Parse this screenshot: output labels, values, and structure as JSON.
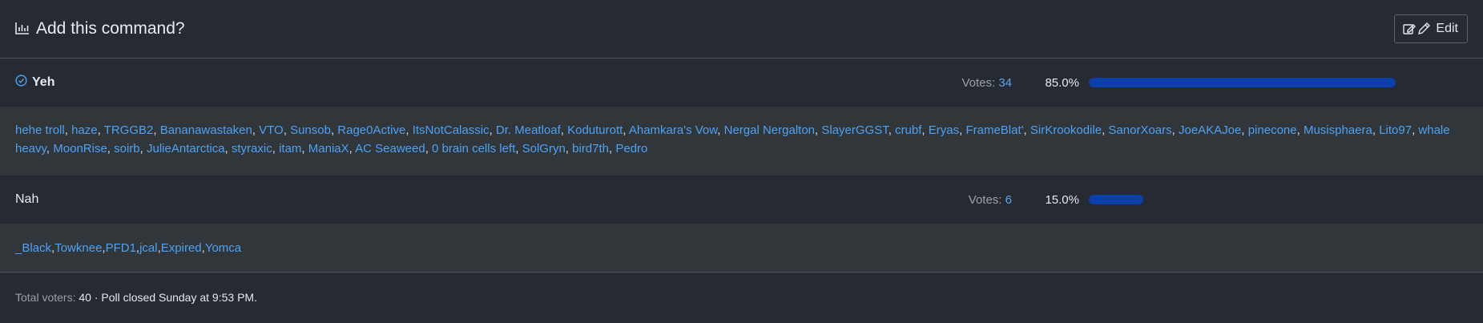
{
  "poll": {
    "title": "Add this command?",
    "edit_label": "Edit",
    "options": [
      {
        "label": "Yeh",
        "votes_label": "Votes:",
        "votes": "34",
        "percent": "85.0%",
        "fraction": 0.85,
        "selected": true,
        "voters": [
          "hehe troll",
          "haze",
          "TRGGB2",
          "Bananawastaken",
          "VTO",
          "Sunsob",
          "Rage0Active",
          "ItsNotCalassic",
          "Dr. Meatloaf",
          "Koduturott",
          "Ahamkara's Vow",
          "Nergal Nergalton",
          "SlayerGGST",
          "crubf",
          "Eryas",
          "FrameBlat'",
          "SirKrookodile",
          "SanorXoars",
          "JoeAKAJoe",
          "pinecone",
          "Musisphaera",
          "Lito97",
          "whale heavy",
          "MoonRise",
          "soirb",
          "JulieAntarctica",
          "styraxic",
          "itam",
          "ManiaX",
          "AC Seaweed",
          "0 brain cells left",
          "SolGryn",
          "bird7th",
          "Pedro"
        ]
      },
      {
        "label": "Nah",
        "votes_label": "Votes:",
        "votes": "6",
        "percent": "15.0%",
        "fraction": 0.15,
        "selected": false,
        "voters": [
          "_Black",
          "Towknee",
          "PFD1",
          "jcal",
          "Expired",
          "Yomca"
        ]
      }
    ],
    "footer": {
      "total_label": "Total voters:",
      "total": "40",
      "closed_text": "· Poll closed Sunday at 9:53 PM."
    }
  },
  "colors": {
    "background": "#262a33",
    "voters_background": "#31363b",
    "link": "#4ea1f3",
    "bar": "#0d3fab"
  },
  "icons": {
    "title_icon": "bar-chart-icon",
    "edit_icon": "edit-icon",
    "selected_icon": "check-circle-icon"
  }
}
